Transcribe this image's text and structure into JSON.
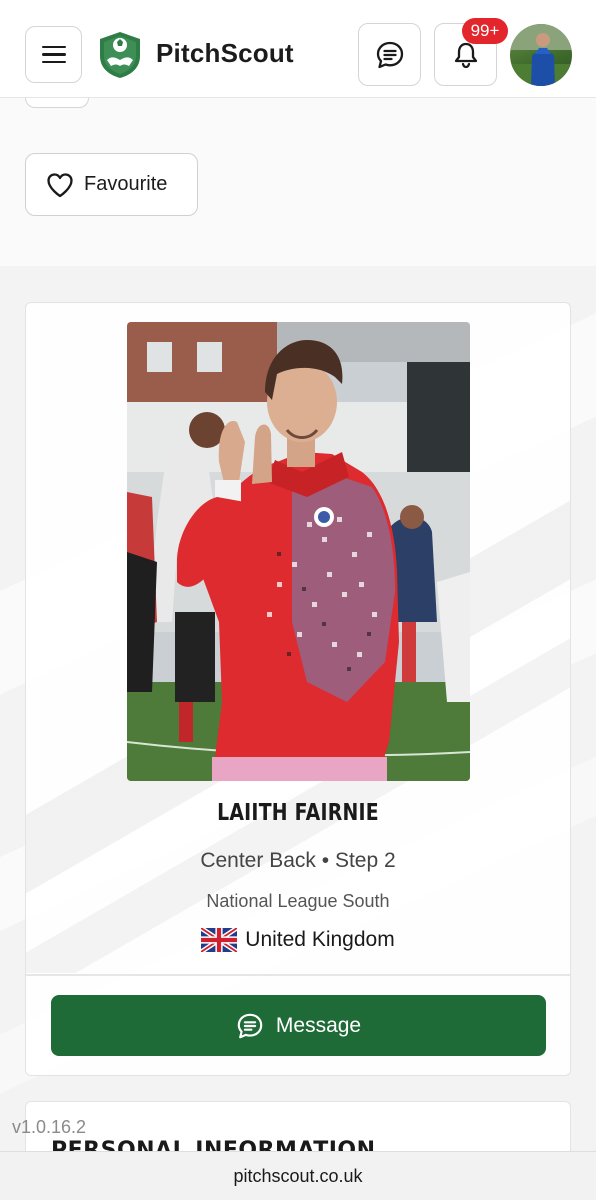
{
  "header": {
    "brand": "PitchScout",
    "notification_badge": "99+",
    "icons": [
      "menu-icon",
      "pitchscout-logo",
      "chat-icon",
      "bell-icon"
    ]
  },
  "actions": {
    "favourite_label": "Favourite"
  },
  "player": {
    "name": "LAIITH FAIRNIE",
    "position": "Center Back",
    "step": "Step 2",
    "separator": "•",
    "league": "National League South",
    "country": "United Kingdom",
    "message_label": "Message"
  },
  "section": {
    "personal_information_title": "PERSONAL INFORMATION"
  },
  "footer": {
    "version": "v1.0.16.2",
    "url": "pitchscout.co.uk"
  },
  "colors": {
    "brand_green": "#1f6b37",
    "badge_red": "#e3262b"
  }
}
